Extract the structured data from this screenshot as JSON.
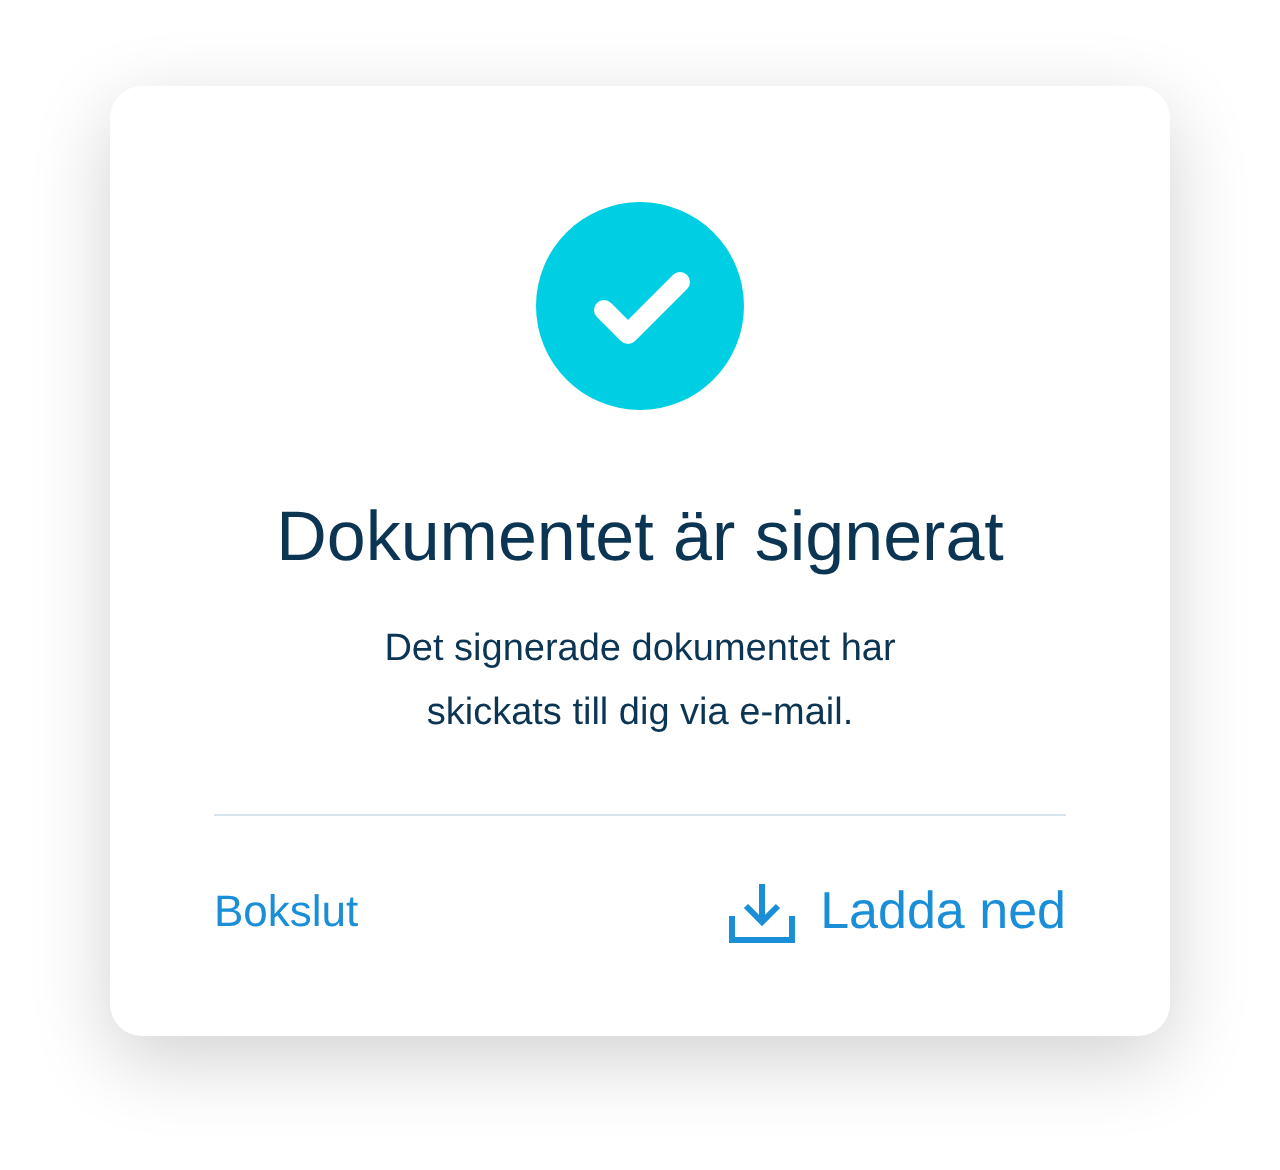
{
  "dialog": {
    "title": "Dokumentet är signerat",
    "message": "Det signerade dokumentet har skickats till dig via e-mail.",
    "links": [
      {
        "kind": "text",
        "label": "Bokslut"
      },
      {
        "kind": "download",
        "label": "Ladda ned"
      }
    ]
  }
}
